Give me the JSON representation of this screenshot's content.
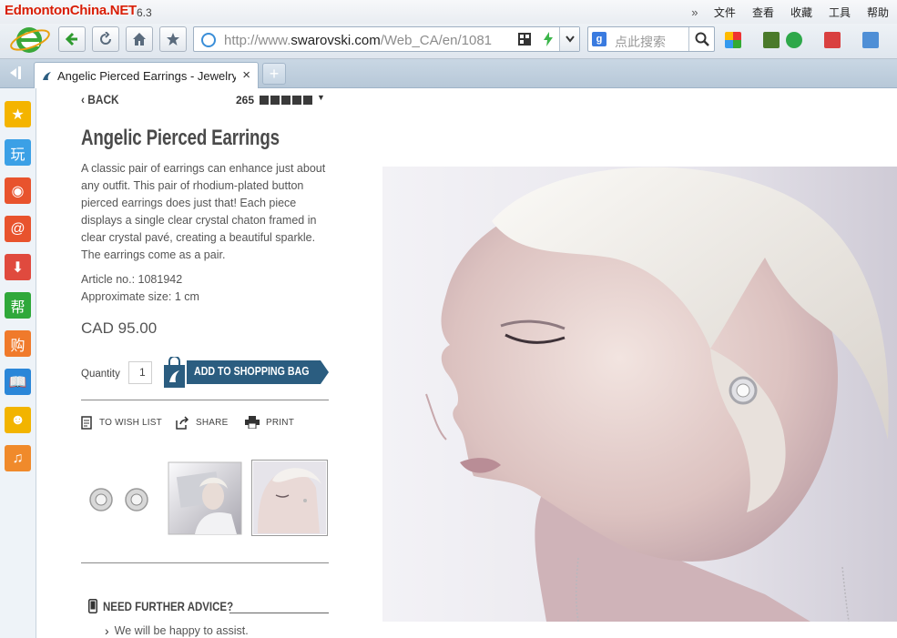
{
  "watermark": "EdmontonChina.NET",
  "app_version": "6.3",
  "menu": {
    "chevron": "»",
    "items": [
      "文件",
      "查看",
      "收藏",
      "工具",
      "帮助"
    ]
  },
  "address": {
    "url_prefix": "http://www.",
    "url_domain": "swarovski.com",
    "url_suffix": "/Web_CA/en/1081"
  },
  "search": {
    "placeholder": "点此搜索"
  },
  "tab": {
    "title": "Angelic Pierced Earrings - Jewelry",
    "close": "×",
    "new_tab": "+"
  },
  "sidebar": {
    "items": [
      {
        "icon": "star-icon",
        "glyph": "★",
        "color": "#f4b400"
      },
      {
        "icon": "play-icon",
        "glyph": "玩",
        "color": "#3ba0e6"
      },
      {
        "icon": "weibo-icon",
        "glyph": "◉",
        "color": "#e8532d"
      },
      {
        "icon": "mail-icon",
        "glyph": "@",
        "color": "#e8532d"
      },
      {
        "icon": "download-icon",
        "glyph": "⬇",
        "color": "#e04a3e"
      },
      {
        "icon": "help-icon",
        "glyph": "帮",
        "color": "#2fa83a"
      },
      {
        "icon": "shopping-icon",
        "glyph": "购",
        "color": "#f07a2b"
      },
      {
        "icon": "book-icon",
        "glyph": "📖",
        "color": "#2a86d8"
      },
      {
        "icon": "fun-face-icon",
        "glyph": "☻",
        "color": "#f2b400"
      },
      {
        "icon": "music-icon",
        "glyph": "♫",
        "color": "#f08a2b"
      }
    ]
  },
  "product": {
    "back_label": "BACK",
    "pager_count": "265",
    "title": "Angelic Pierced Earrings",
    "description": "A classic pair of earrings can enhance just about any outfit. This pair of rhodium-plated button pierced earrings does just that! Each piece displays a single clear crystal chaton framed in clear crystal pavé, creating a beautiful sparkle. The earrings come as a pair.",
    "article_no": "Article no.: 1081942",
    "size": "Approximate size: 1 cm",
    "price": "CAD 95.00",
    "quantity_label": "Quantity",
    "quantity_value": "1",
    "add_to_bag": "ADD TO SHOPPING BAG",
    "actions": {
      "wishlist": "TO WISH LIST",
      "share": "SHARE",
      "print": "PRINT"
    },
    "advice_title": "NEED FURTHER ADVICE?",
    "advice_text": "We will be happy to assist."
  },
  "colors": {
    "brand_blue": "#2b5d80",
    "text": "#555555"
  }
}
